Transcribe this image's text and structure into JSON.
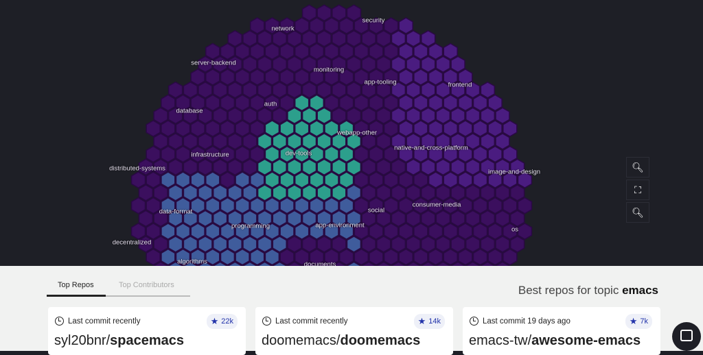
{
  "map": {
    "labels": [
      "network",
      "security",
      "server-backend",
      "monitoring",
      "app-tooling",
      "frontend",
      "database",
      "auth",
      "webapp-other",
      "native-and-cross-platform",
      "infrastructure",
      "dev-tools",
      "distributed-systems",
      "image-and-design",
      "data-format",
      "social",
      "consumer-media",
      "programming",
      "app-environment",
      "os",
      "decentralized",
      "algorithms",
      "documents"
    ],
    "colors": {
      "background": "#1e1f26",
      "base": "#3b0f5e",
      "frontend": "#4a1c80",
      "dev_tools": "#2c9f8c",
      "programming": "#3f5c9c",
      "selected": "#e8ea1f"
    }
  },
  "controls": {
    "zoom_in": "zoom-in",
    "fit": "fit-screen",
    "zoom_out": "zoom-out"
  },
  "tabs": [
    "Top Repos",
    "Top Contributors"
  ],
  "heading": {
    "prefix": "Best repos for topic ",
    "topic": "emacs"
  },
  "repos": [
    {
      "commit": "Last commit recently",
      "stars": "22k",
      "owner": "syl20bnr/",
      "name": "spacemacs"
    },
    {
      "commit": "Last commit recently",
      "stars": "14k",
      "owner": "doomemacs/",
      "name": "doomemacs"
    },
    {
      "commit": "Last commit 19 days ago",
      "stars": "7k",
      "owner": "emacs-tw/",
      "name": "awesome-emacs"
    }
  ]
}
